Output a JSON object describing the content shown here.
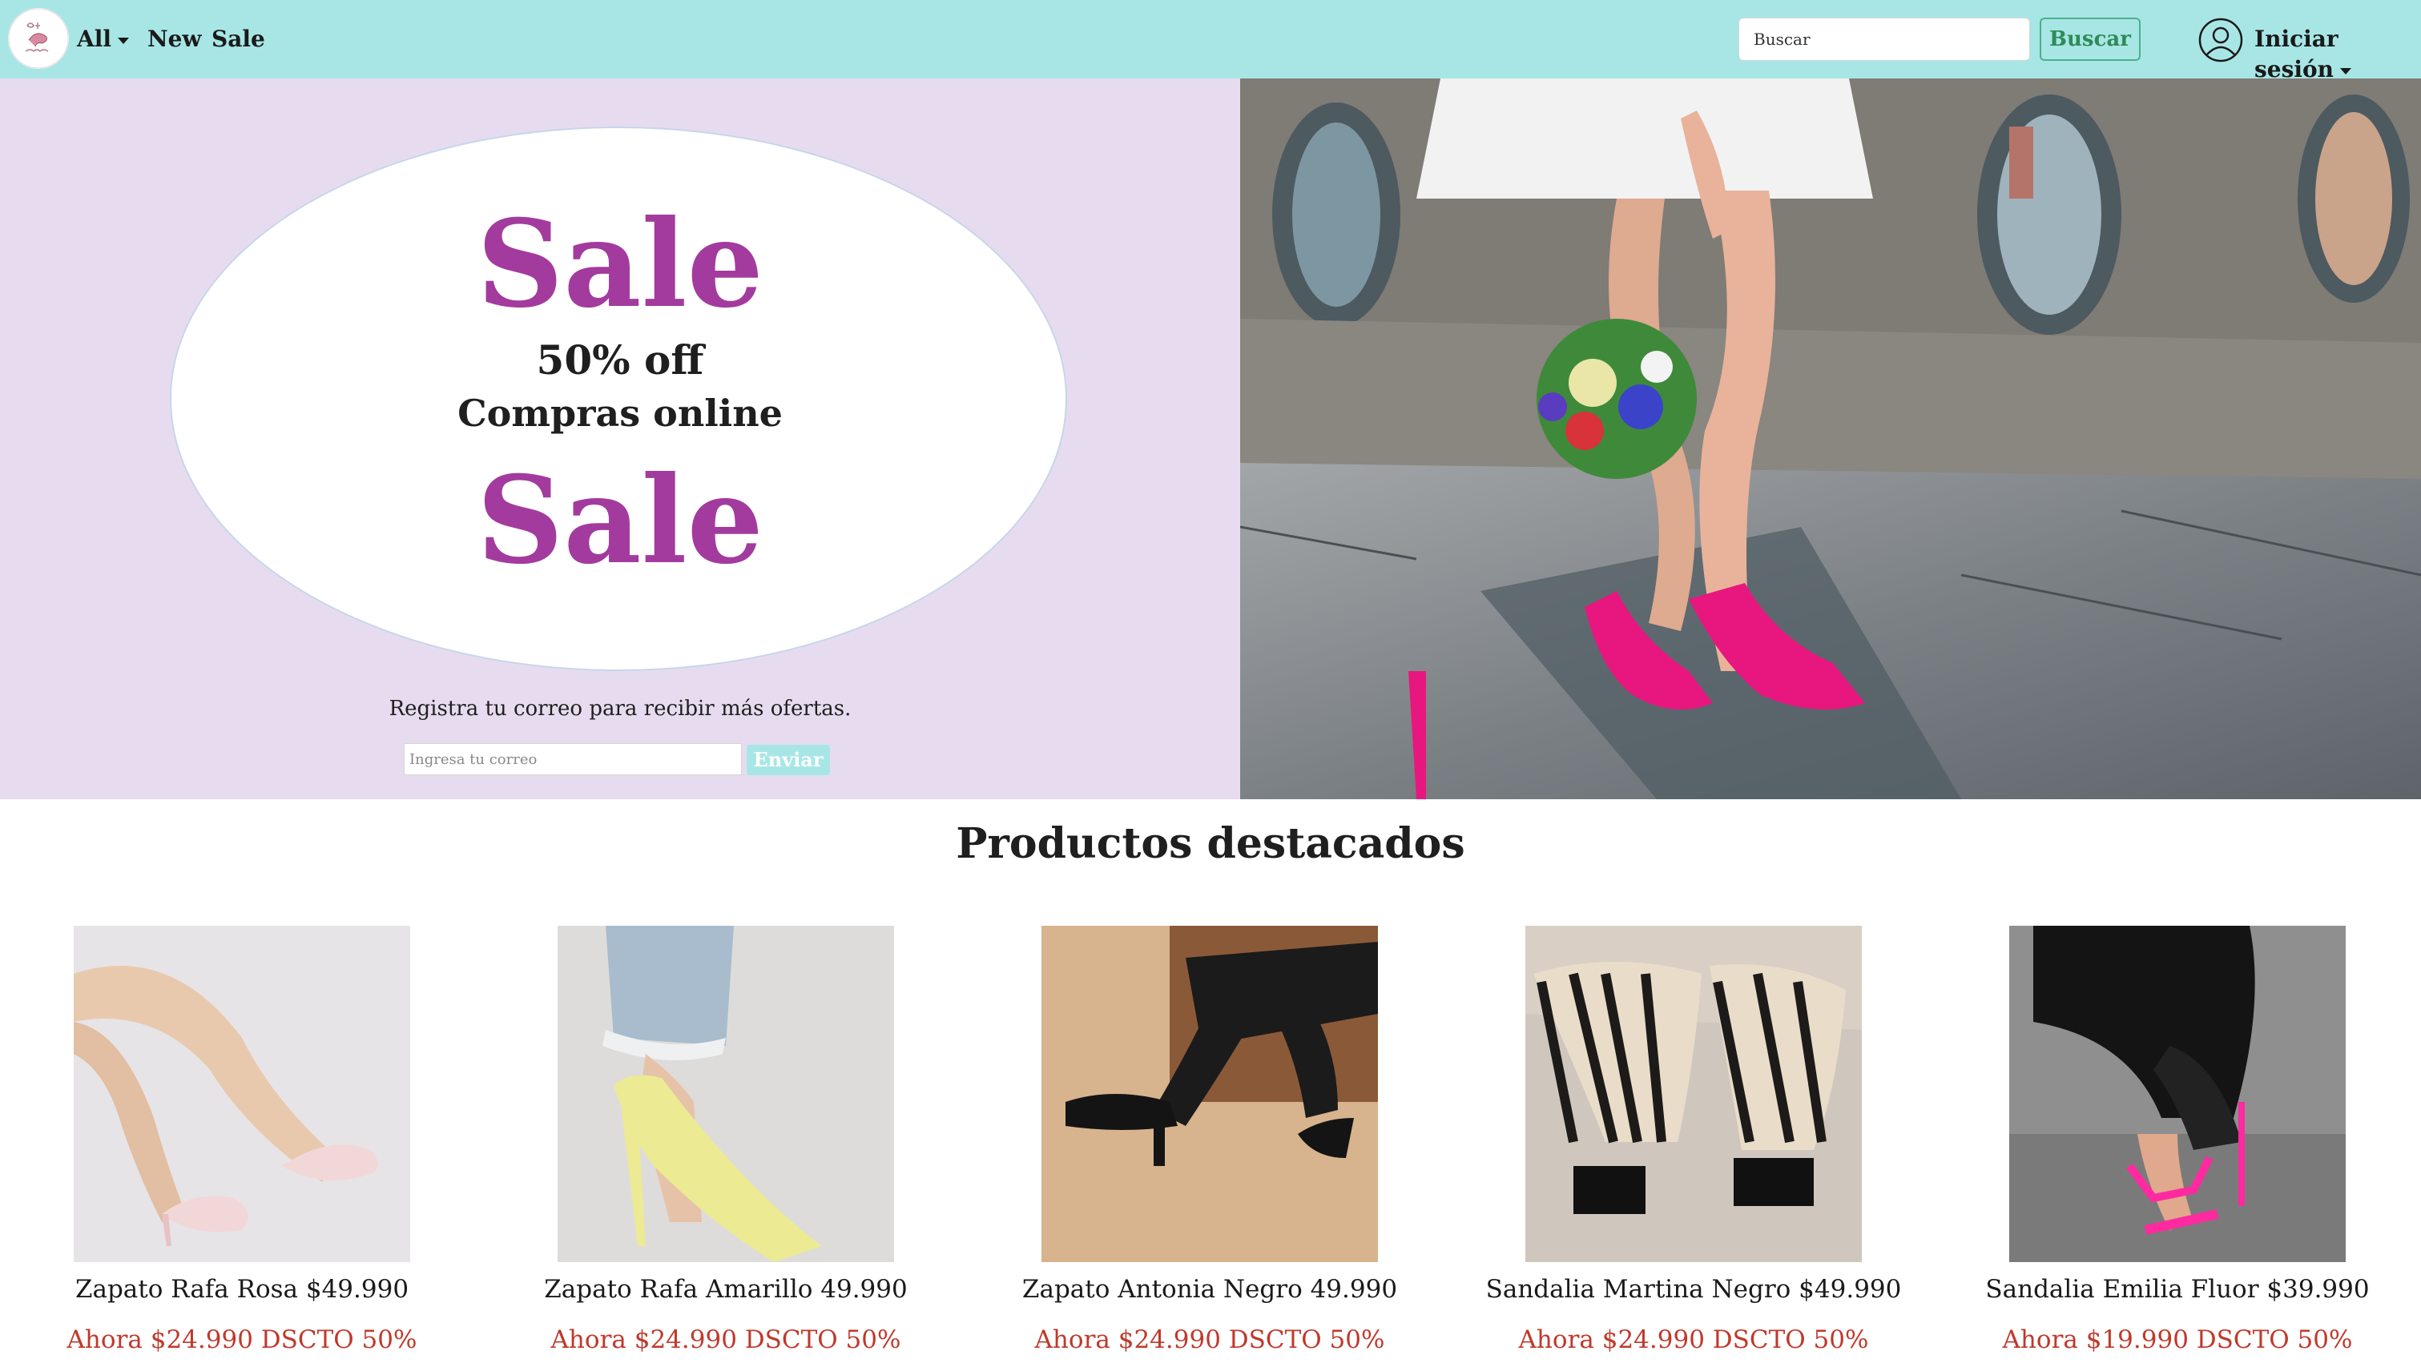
{
  "navbar": {
    "menu_all": "All",
    "menu_new": "New",
    "menu_sale": "Sale",
    "search_placeholder": "Buscar",
    "search_button": "Buscar",
    "login": "Iniciar sesión",
    "brand_color": "#a8e6e6"
  },
  "hero": {
    "sale_top": "Sale",
    "discount": "50% off",
    "subtitle": "Compras online",
    "sale_bottom": "Sale",
    "register_text": "Registra tu correo para recibir más ofertas.",
    "email_placeholder": "Ingresa tu correo",
    "send_button": "Enviar",
    "accent_color": "#a33b9e",
    "panel_color": "#e7dcef"
  },
  "featured": {
    "title": "Productos destacados",
    "products": [
      {
        "name": "Zapato Rafa Rosa $49.990",
        "price": "Ahora $24.990 DSCTO 50%"
      },
      {
        "name": "Zapato Rafa Amarillo 49.990",
        "price": "Ahora $24.990 DSCTO 50%"
      },
      {
        "name": "Zapato Antonia Negro 49.990",
        "price": "Ahora $24.990 DSCTO 50%"
      },
      {
        "name": "Sandalia Martina Negro $49.990",
        "price": "Ahora $24.990 DSCTO 50%"
      },
      {
        "name": "Sandalia Emilia Fluor $39.990",
        "price": "Ahora $19.990 DSCTO 50%"
      }
    ],
    "price_color": "#c0392b"
  }
}
